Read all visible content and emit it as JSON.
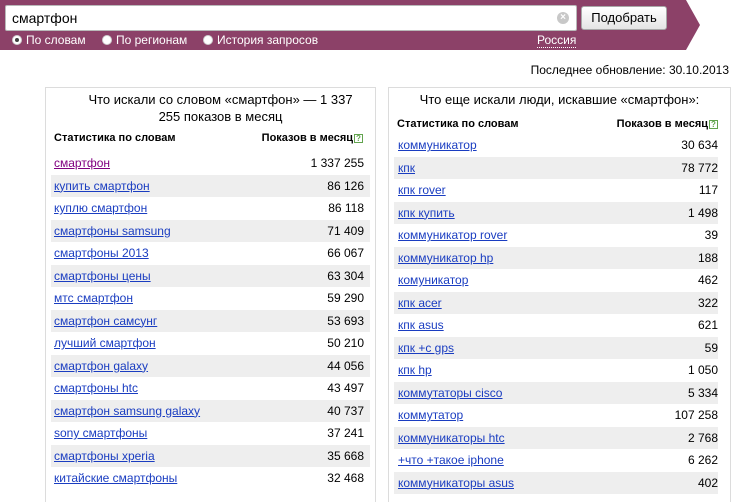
{
  "search": {
    "value": "смартфон",
    "button_label": "Подобрать",
    "clear_glyph": "×"
  },
  "modes": [
    {
      "label": "По словам",
      "selected": true
    },
    {
      "label": "По регионам",
      "selected": false
    },
    {
      "label": "История запросов",
      "selected": false
    }
  ],
  "region": "Россия",
  "updated": "Последнее обновление: 30.10.2013",
  "left_panel": {
    "title": "Что искали со словом «смартфон» — 1 337 255 показов в месяц",
    "col_phrase": "Статистика по словам",
    "col_count": "Показов в месяц",
    "help_glyph": "?",
    "rows": [
      {
        "phrase": "смартфон",
        "count": "1 337 255"
      },
      {
        "phrase": "купить смартфон",
        "count": "86 126"
      },
      {
        "phrase": "куплю смартфон",
        "count": "86 118"
      },
      {
        "phrase": "смартфоны samsung",
        "count": "71 409"
      },
      {
        "phrase": "смартфоны 2013",
        "count": "66 067"
      },
      {
        "phrase": "смартфоны цены",
        "count": "63 304"
      },
      {
        "phrase": "мтс смартфон",
        "count": "59 290"
      },
      {
        "phrase": "смартфон самсунг",
        "count": "53 693"
      },
      {
        "phrase": "лучший смартфон",
        "count": "50 210"
      },
      {
        "phrase": "смартфон galaxy",
        "count": "44 056"
      },
      {
        "phrase": "смартфоны htc",
        "count": "43 497"
      },
      {
        "phrase": "смартфон samsung galaxy",
        "count": "40 737"
      },
      {
        "phrase": "sony смартфоны",
        "count": "37 241"
      },
      {
        "phrase": "смартфоны xperia",
        "count": "35 668"
      },
      {
        "phrase": "китайские смартфоны",
        "count": "32 468"
      }
    ]
  },
  "right_panel": {
    "title": "Что еще искали люди, искавшие «смартфон»:",
    "col_phrase": "Статистика по словам",
    "col_count": "Показов в месяц",
    "help_glyph": "?",
    "rows": [
      {
        "phrase": "коммуникатор",
        "count": "30 634"
      },
      {
        "phrase": "кпк",
        "count": "78 772"
      },
      {
        "phrase": "кпк rover",
        "count": "117"
      },
      {
        "phrase": "кпк купить",
        "count": "1 498"
      },
      {
        "phrase": "коммуникатор rover",
        "count": "39"
      },
      {
        "phrase": "коммуникатор hp",
        "count": "188"
      },
      {
        "phrase": "комуникатор",
        "count": "462"
      },
      {
        "phrase": "кпк acer",
        "count": "322"
      },
      {
        "phrase": "кпк asus",
        "count": "621"
      },
      {
        "phrase": "кпк +с gps",
        "count": "59"
      },
      {
        "phrase": "кпк hp",
        "count": "1 050"
      },
      {
        "phrase": "коммутаторы cisco",
        "count": "5 334"
      },
      {
        "phrase": "коммутатор",
        "count": "107 258"
      },
      {
        "phrase": "коммуникаторы htc",
        "count": "2 768"
      },
      {
        "phrase": "+что +такое iphone",
        "count": "6 262"
      },
      {
        "phrase": "коммуникаторы asus",
        "count": "402"
      }
    ]
  }
}
